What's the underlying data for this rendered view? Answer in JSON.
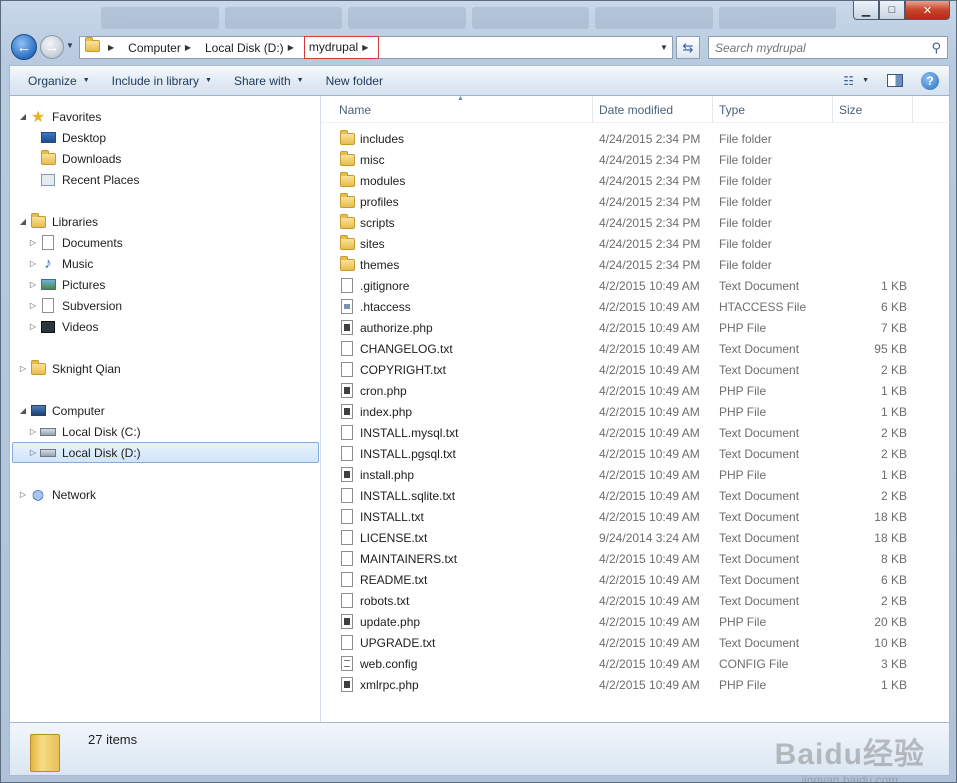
{
  "window": {
    "controls": [
      "minimize",
      "maximize",
      "close"
    ]
  },
  "address": {
    "crumbs": [
      "Computer",
      "Local Disk (D:)",
      "mydrupal"
    ]
  },
  "search": {
    "placeholder": "Search mydrupal"
  },
  "toolbar": {
    "organize": "Organize",
    "include_in_library": "Include in library",
    "share_with": "Share with",
    "new_folder": "New folder"
  },
  "nav": {
    "favorites": "Favorites",
    "desktop": "Desktop",
    "downloads": "Downloads",
    "recent_places": "Recent Places",
    "libraries": "Libraries",
    "documents": "Documents",
    "music": "Music",
    "pictures": "Pictures",
    "subversion": "Subversion",
    "videos": "Videos",
    "user": "Sknight Qian",
    "computer": "Computer",
    "local_c": "Local Disk (C:)",
    "local_d": "Local Disk (D:)",
    "network": "Network"
  },
  "columns": {
    "name": "Name",
    "date": "Date modified",
    "type": "Type",
    "size": "Size"
  },
  "files": [
    {
      "name": "includes",
      "date": "4/24/2015 2:34 PM",
      "type": "File folder",
      "size": "",
      "icon": "folder"
    },
    {
      "name": "misc",
      "date": "4/24/2015 2:34 PM",
      "type": "File folder",
      "size": "",
      "icon": "folder"
    },
    {
      "name": "modules",
      "date": "4/24/2015 2:34 PM",
      "type": "File folder",
      "size": "",
      "icon": "folder"
    },
    {
      "name": "profiles",
      "date": "4/24/2015 2:34 PM",
      "type": "File folder",
      "size": "",
      "icon": "folder"
    },
    {
      "name": "scripts",
      "date": "4/24/2015 2:34 PM",
      "type": "File folder",
      "size": "",
      "icon": "folder"
    },
    {
      "name": "sites",
      "date": "4/24/2015 2:34 PM",
      "type": "File folder",
      "size": "",
      "icon": "folder"
    },
    {
      "name": "themes",
      "date": "4/24/2015 2:34 PM",
      "type": "File folder",
      "size": "",
      "icon": "folder"
    },
    {
      "name": ".gitignore",
      "date": "4/2/2015 10:49 AM",
      "type": "Text Document",
      "size": "1 KB",
      "icon": "txt"
    },
    {
      "name": ".htaccess",
      "date": "4/2/2015 10:49 AM",
      "type": "HTACCESS File",
      "size": "6 KB",
      "icon": "ht"
    },
    {
      "name": "authorize.php",
      "date": "4/2/2015 10:49 AM",
      "type": "PHP File",
      "size": "7 KB",
      "icon": "php"
    },
    {
      "name": "CHANGELOG.txt",
      "date": "4/2/2015 10:49 AM",
      "type": "Text Document",
      "size": "95 KB",
      "icon": "txt"
    },
    {
      "name": "COPYRIGHT.txt",
      "date": "4/2/2015 10:49 AM",
      "type": "Text Document",
      "size": "2 KB",
      "icon": "txt"
    },
    {
      "name": "cron.php",
      "date": "4/2/2015 10:49 AM",
      "type": "PHP File",
      "size": "1 KB",
      "icon": "php"
    },
    {
      "name": "index.php",
      "date": "4/2/2015 10:49 AM",
      "type": "PHP File",
      "size": "1 KB",
      "icon": "php"
    },
    {
      "name": "INSTALL.mysql.txt",
      "date": "4/2/2015 10:49 AM",
      "type": "Text Document",
      "size": "2 KB",
      "icon": "txt"
    },
    {
      "name": "INSTALL.pgsql.txt",
      "date": "4/2/2015 10:49 AM",
      "type": "Text Document",
      "size": "2 KB",
      "icon": "txt"
    },
    {
      "name": "install.php",
      "date": "4/2/2015 10:49 AM",
      "type": "PHP File",
      "size": "1 KB",
      "icon": "php"
    },
    {
      "name": "INSTALL.sqlite.txt",
      "date": "4/2/2015 10:49 AM",
      "type": "Text Document",
      "size": "2 KB",
      "icon": "txt"
    },
    {
      "name": "INSTALL.txt",
      "date": "4/2/2015 10:49 AM",
      "type": "Text Document",
      "size": "18 KB",
      "icon": "txt"
    },
    {
      "name": "LICENSE.txt",
      "date": "9/24/2014 3:24 AM",
      "type": "Text Document",
      "size": "18 KB",
      "icon": "txt"
    },
    {
      "name": "MAINTAINERS.txt",
      "date": "4/2/2015 10:49 AM",
      "type": "Text Document",
      "size": "8 KB",
      "icon": "txt"
    },
    {
      "name": "README.txt",
      "date": "4/2/2015 10:49 AM",
      "type": "Text Document",
      "size": "6 KB",
      "icon": "txt"
    },
    {
      "name": "robots.txt",
      "date": "4/2/2015 10:49 AM",
      "type": "Text Document",
      "size": "2 KB",
      "icon": "txt"
    },
    {
      "name": "update.php",
      "date": "4/2/2015 10:49 AM",
      "type": "PHP File",
      "size": "20 KB",
      "icon": "php"
    },
    {
      "name": "UPGRADE.txt",
      "date": "4/2/2015 10:49 AM",
      "type": "Text Document",
      "size": "10 KB",
      "icon": "txt"
    },
    {
      "name": "web.config",
      "date": "4/2/2015 10:49 AM",
      "type": "CONFIG File",
      "size": "3 KB",
      "icon": "cfg"
    },
    {
      "name": "xmlrpc.php",
      "date": "4/2/2015 10:49 AM",
      "type": "PHP File",
      "size": "1 KB",
      "icon": "php"
    }
  ],
  "status": {
    "item_count": "27 items"
  },
  "watermark": {
    "line1": "Baidu经验",
    "line2": "jingyan.baidu.com"
  }
}
